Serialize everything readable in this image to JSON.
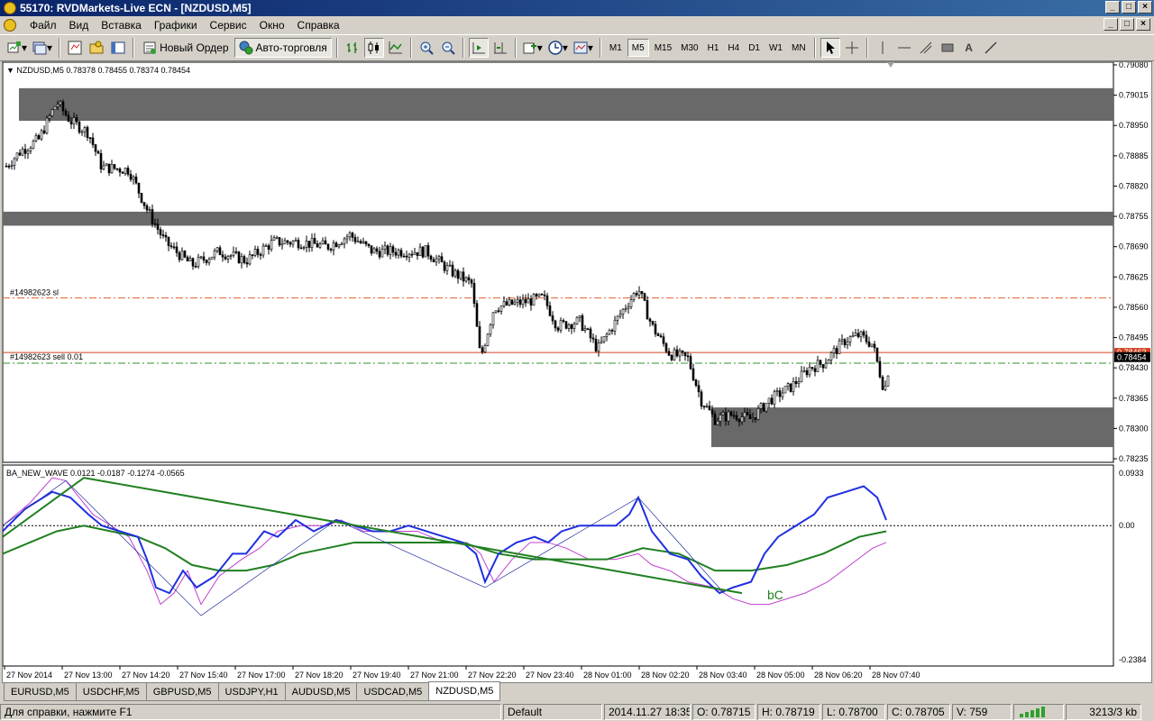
{
  "title": "55170: RVDMarkets-Live ECN - [NZDUSD,M5]",
  "menu": [
    "Файл",
    "Вид",
    "Вставка",
    "Графики",
    "Сервис",
    "Окно",
    "Справка"
  ],
  "toolbar": {
    "new_order": "Новый Ордер",
    "auto_trading": "Авто-торговля",
    "timeframes": [
      "M1",
      "M5",
      "M15",
      "M30",
      "H1",
      "H4",
      "D1",
      "W1",
      "MN"
    ],
    "active_timeframe": "M5",
    "text_tool": "A"
  },
  "chart": {
    "info": "NZDUSD,M5  0.78378 0.78455 0.78374 0.78454",
    "price_labels": [
      "0.79080",
      "0.79015",
      "0.78950",
      "0.78885",
      "0.78820",
      "0.78755",
      "0.78690",
      "0.78625",
      "0.78560",
      "0.78495",
      "0.78430",
      "0.78365",
      "0.78300",
      "0.78235"
    ],
    "current_price": "0.78454",
    "order_price": "0.78463",
    "sl_label": "#14982623 sl",
    "sell_label": "#14982623 sell 0.01",
    "indicator_info": "BA_NEW_WAVE 0.0121 -0.0187 -0.1274 -0.0565",
    "indicator_labels": [
      "0.0933",
      "0.00",
      "-0.2384"
    ],
    "indicator_annotation": "bC",
    "time_labels": [
      "27 Nov 2014",
      "27 Nov 13:00",
      "27 Nov 14:20",
      "27 Nov 15:40",
      "27 Nov 17:00",
      "27 Nov 18:20",
      "27 Nov 19:40",
      "27 Nov 21:00",
      "27 Nov 22:20",
      "27 Nov 23:40",
      "28 Nov 01:00",
      "28 Nov 02:20",
      "28 Nov 03:40",
      "28 Nov 05:00",
      "28 Nov 06:20",
      "28 Nov 07:40"
    ],
    "colors": {
      "zone": "#696969",
      "sl_line": "#e06030",
      "sell_line": "#309030",
      "price_line": "#d04020",
      "blue_wave": "#2030e0",
      "green_wave": "#208020",
      "purple_wave": "#c040d0"
    }
  },
  "tabs": [
    "EURUSD,M5",
    "USDCHF,M5",
    "GBPUSD,M5",
    "USDJPY,H1",
    "AUDUSD,M5",
    "USDCAD,M5",
    "NZDUSD,M5"
  ],
  "active_tab": "NZDUSD,M5",
  "status": {
    "help": "Для справки, нажмите F1",
    "profile": "Default",
    "datetime": "2014.11.27 18:35",
    "open": "O: 0.78715",
    "high": "H: 0.78719",
    "low": "L: 0.78700",
    "close": "C: 0.78705",
    "volume": "V: 759",
    "traffic": "3213/3 kb"
  }
}
